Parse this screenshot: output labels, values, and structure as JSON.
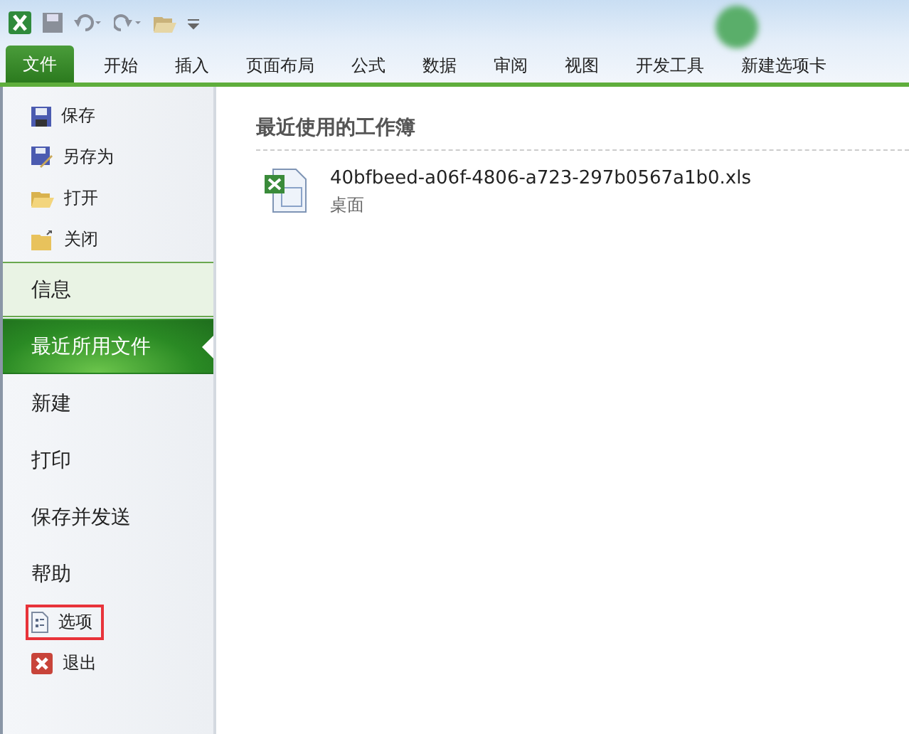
{
  "tabs": [
    {
      "label": "文件",
      "selected": true
    },
    {
      "label": "开始",
      "selected": false
    },
    {
      "label": "插入",
      "selected": false
    },
    {
      "label": "页面布局",
      "selected": false
    },
    {
      "label": "公式",
      "selected": false
    },
    {
      "label": "数据",
      "selected": false
    },
    {
      "label": "审阅",
      "selected": false
    },
    {
      "label": "视图",
      "selected": false
    },
    {
      "label": "开发工具",
      "selected": false
    },
    {
      "label": "新建选项卡",
      "selected": false
    }
  ],
  "menu": [
    {
      "kind": "small",
      "label": "保存",
      "marked": false
    },
    {
      "kind": "small",
      "label": "另存为",
      "marked": false
    },
    {
      "kind": "small",
      "label": "打开",
      "marked": false
    },
    {
      "kind": "small",
      "label": "关闭",
      "marked": false
    },
    {
      "kind": "large",
      "label": "信息",
      "selected": false,
      "highlighted": true
    },
    {
      "kind": "large",
      "label": "最近所用文件",
      "selected": true,
      "highlighted": false
    },
    {
      "kind": "large",
      "label": "新建",
      "selected": false,
      "highlighted": false
    },
    {
      "kind": "large",
      "label": "打印",
      "selected": false,
      "highlighted": false
    },
    {
      "kind": "large",
      "label": "保存并发送",
      "selected": false,
      "highlighted": false
    },
    {
      "kind": "large",
      "label": "帮助",
      "selected": false,
      "highlighted": false
    },
    {
      "kind": "small",
      "label": "选项",
      "marked": true
    },
    {
      "kind": "small",
      "label": "退出",
      "marked": false
    }
  ],
  "recent": {
    "title": "最近使用的工作簿",
    "files": [
      {
        "name": "40bfbeed-a06f-4806-a723-297b0567a1b0.xls",
        "location": "桌面"
      }
    ]
  }
}
